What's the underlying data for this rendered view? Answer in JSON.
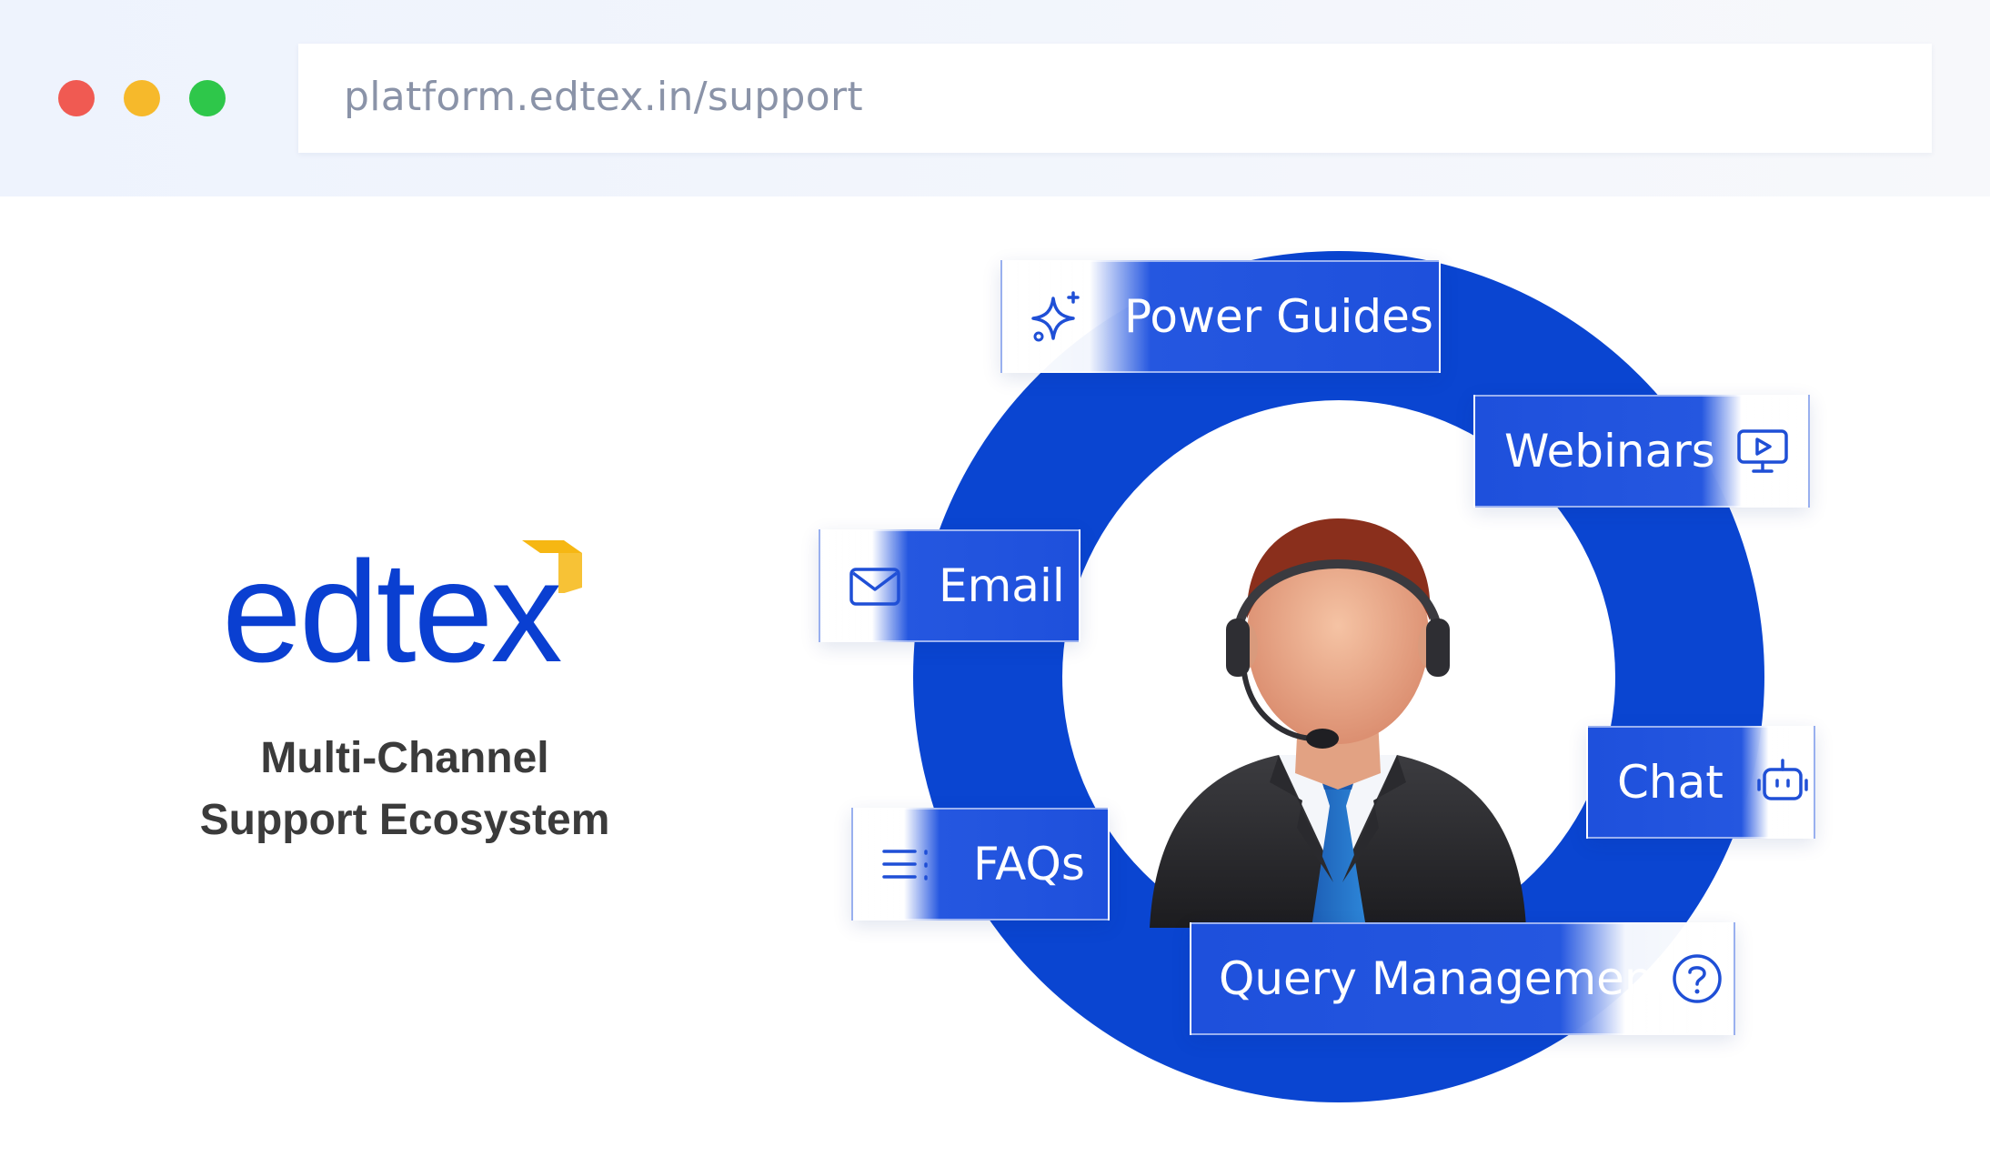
{
  "browser": {
    "url": "platform.edtex.in/support",
    "traffic_lights": {
      "close": "#f05a52",
      "minimize": "#f6b92b",
      "maximize": "#2ec74a"
    }
  },
  "brand": {
    "logo_text": "edtex",
    "logo_color": "#0a3fd1",
    "accent_color": "#f6b713",
    "tagline_line1": "Multi-Channel",
    "tagline_line2": "Support Ecosystem"
  },
  "diagram": {
    "ring_color": "#0a45d1",
    "center_icon": "support-agent-with-headset",
    "channels": [
      {
        "label": "Power Guides",
        "icon": "sparkle-icon"
      },
      {
        "label": "Webinars",
        "icon": "monitor-play-icon"
      },
      {
        "label": "Email",
        "icon": "mail-icon"
      },
      {
        "label": "Chat",
        "icon": "bot-icon"
      },
      {
        "label": "FAQs",
        "icon": "list-icon"
      },
      {
        "label": "Query Management",
        "icon": "question-circle-icon"
      }
    ]
  }
}
